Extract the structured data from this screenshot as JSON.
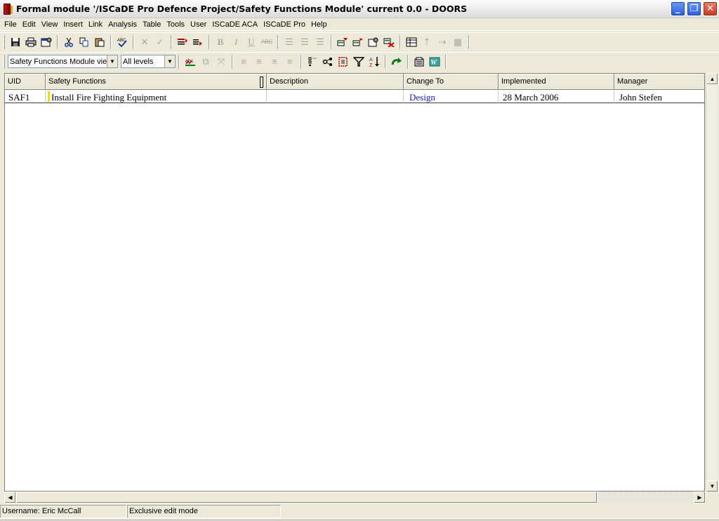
{
  "window": {
    "title": "Formal module '/ISCaDE Pro Defence Project/Safety Functions Module' current 0.0 - DOORS",
    "controls": [
      "_",
      "❐",
      "✕"
    ]
  },
  "menu": [
    "File",
    "Edit",
    "View",
    "Insert",
    "Link",
    "Analysis",
    "Table",
    "Tools",
    "User",
    "ISCaDE ACA",
    "ISCaDE Pro",
    "Help"
  ],
  "toolbar": {
    "view_select": "Safety Functions Module view",
    "level_select": "All levels",
    "icons": {
      "save": "save-icon",
      "print": "print-icon",
      "properties": "properties-icon",
      "cut": "cut-icon",
      "copy": "copy-icon",
      "paste": "paste-icon",
      "spell": "spell-check-icon",
      "delete": "delete-icon",
      "check": "check-icon",
      "bold": "B",
      "italic": "I",
      "underline": "U",
      "strike": "ABC"
    }
  },
  "table": {
    "columns": [
      "UID",
      "Safety Functions",
      "Description",
      "Change To",
      "Implemented",
      "Manager"
    ],
    "rows": [
      {
        "uid": "SAF1",
        "safety_function": "Install Fire Fighting Equipment",
        "description": "",
        "change_to": "Design",
        "implemented": "28 March 2006",
        "manager": "John Stefen"
      }
    ]
  },
  "status": {
    "user": "Username: Eric McCall",
    "mode": "Exclusive edit mode"
  },
  "colors": {
    "link_text": "#1a1ab8",
    "header_bg": "#ece9d8",
    "marker": "#f0e000"
  }
}
